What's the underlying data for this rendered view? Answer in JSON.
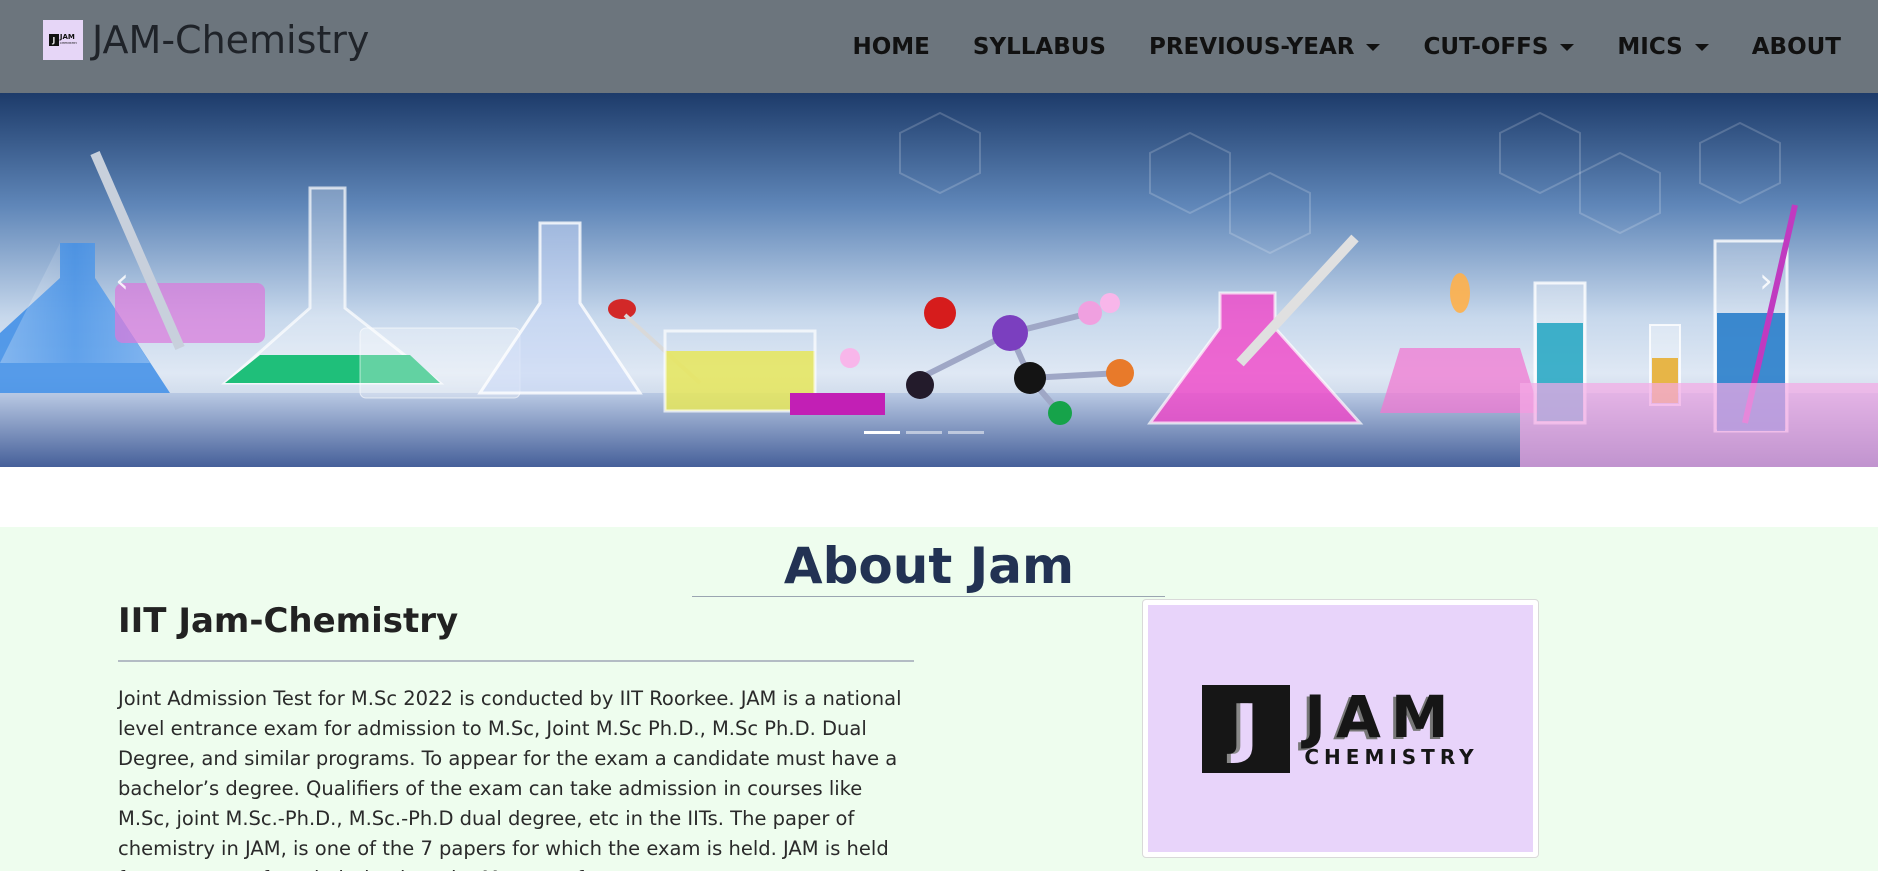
{
  "navbar": {
    "brand_text": "JAM-Chemistry",
    "logo": {
      "letter": "J",
      "line1": "JAM",
      "line2": "CHEMISTRY"
    },
    "items": [
      {
        "label": "HOME",
        "dropdown": false
      },
      {
        "label": "SYLLABUS",
        "dropdown": false
      },
      {
        "label": "PREVIOUS-YEAR",
        "dropdown": true
      },
      {
        "label": "CUT-OFFS",
        "dropdown": true
      },
      {
        "label": "MICS",
        "dropdown": true
      },
      {
        "label": "ABOUT",
        "dropdown": false
      }
    ]
  },
  "hero": {
    "prev_icon": "‹",
    "next_icon": "›",
    "slides": 3,
    "active_slide": 1
  },
  "about": {
    "heading": "About Jam",
    "subheading": "IIT Jam-Chemistry",
    "paragraph": "Joint Admission Test for M.Sc 2022 is conducted by IIT Roorkee. JAM is a national level entrance exam for admission to M.Sc, Joint M.Sc Ph.D., M.Sc Ph.D. Dual Degree, and similar programs. To appear for the exam a candidate must have a bachelor’s degree. Qualifiers of the exam can take admission in courses like M.Sc, joint M.Sc.-Ph.D., M.Sc.-Ph.D dual degree, etc in the IITs. The paper of chemistry in JAM, is one of the 7 papers for which the exam is held. JAM is held for every year for admission into the Masters of",
    "logo": {
      "letter": "J",
      "line1": "JAM",
      "line2": "CHEMISTRY"
    }
  },
  "colors": {
    "navbar_bg": "#6c757d",
    "about_bg": "#eefdee",
    "heading": "#223253",
    "logo_bg": "#e8d4fa"
  }
}
